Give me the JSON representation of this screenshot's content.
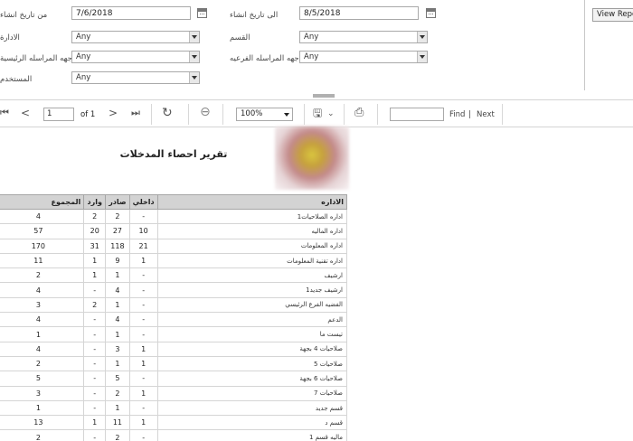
{
  "params": {
    "from_date_label": "من تاريخ انشاء",
    "from_date_value": "7/6/2018",
    "to_date_label": "الى تاريخ انشاء",
    "to_date_value": "8/5/2018",
    "admin_label": "الادارة",
    "admin_value": "Any",
    "section_label": "القسم",
    "section_value": "Any",
    "main_corr_label": "جهه المراسله الرئيسية",
    "main_corr_value": "Any",
    "sub_corr_label": "جهه المراسله الفرعيه",
    "sub_corr_value": "Any",
    "user_label": "المستخدم",
    "user_value": "Any",
    "view_report": "View Report"
  },
  "toolbar": {
    "page_value": "1",
    "of_label": "of 1",
    "zoom_value": "100%",
    "find_label": "Find",
    "separator": "|",
    "next_label": "Next"
  },
  "report": {
    "title": "تقرير احصاء المدخلات",
    "headers": {
      "total": "المجموع",
      "incoming": "وارد",
      "outgoing": "صادر",
      "internal": "داخلي",
      "department": "الاداره"
    },
    "rows": [
      {
        "total": "4",
        "incoming": "2",
        "outgoing": "2",
        "internal": "-",
        "department": "اداره الصلاحيات1"
      },
      {
        "total": "57",
        "incoming": "20",
        "outgoing": "27",
        "internal": "10",
        "department": "اداره الماليه"
      },
      {
        "total": "170",
        "incoming": "31",
        "outgoing": "118",
        "internal": "21",
        "department": "اداره المعلومات"
      },
      {
        "total": "11",
        "incoming": "1",
        "outgoing": "9",
        "internal": "1",
        "department": "اداره تقنية المعلومات"
      },
      {
        "total": "2",
        "incoming": "1",
        "outgoing": "1",
        "internal": "-",
        "department": "ارشيف"
      },
      {
        "total": "4",
        "incoming": "-",
        "outgoing": "4",
        "internal": "-",
        "department": "ارشيف جديد1"
      },
      {
        "total": "3",
        "incoming": "2",
        "outgoing": "1",
        "internal": "-",
        "department": "الفضيه الفرع الرئيسي"
      },
      {
        "total": "4",
        "incoming": "-",
        "outgoing": "4",
        "internal": "-",
        "department": "الدعم"
      },
      {
        "total": "1",
        "incoming": "-",
        "outgoing": "1",
        "internal": "-",
        "department": "تيست ما"
      },
      {
        "total": "4",
        "incoming": "-",
        "outgoing": "3",
        "internal": "1",
        "department": "صلاحيات 4 بجهة"
      },
      {
        "total": "2",
        "incoming": "-",
        "outgoing": "1",
        "internal": "1",
        "department": "صلاحيات 5"
      },
      {
        "total": "5",
        "incoming": "-",
        "outgoing": "5",
        "internal": "-",
        "department": "صلاحيات 6 بجهة"
      },
      {
        "total": "3",
        "incoming": "-",
        "outgoing": "2",
        "internal": "1",
        "department": "صلاحيات 7"
      },
      {
        "total": "1",
        "incoming": "-",
        "outgoing": "1",
        "internal": "-",
        "department": "قسم جديد"
      },
      {
        "total": "13",
        "incoming": "1",
        "outgoing": "11",
        "internal": "1",
        "department": "قسم د"
      },
      {
        "total": "2",
        "incoming": "-",
        "outgoing": "2",
        "internal": "-",
        "department": "ماليه قسم 1"
      }
    ]
  }
}
